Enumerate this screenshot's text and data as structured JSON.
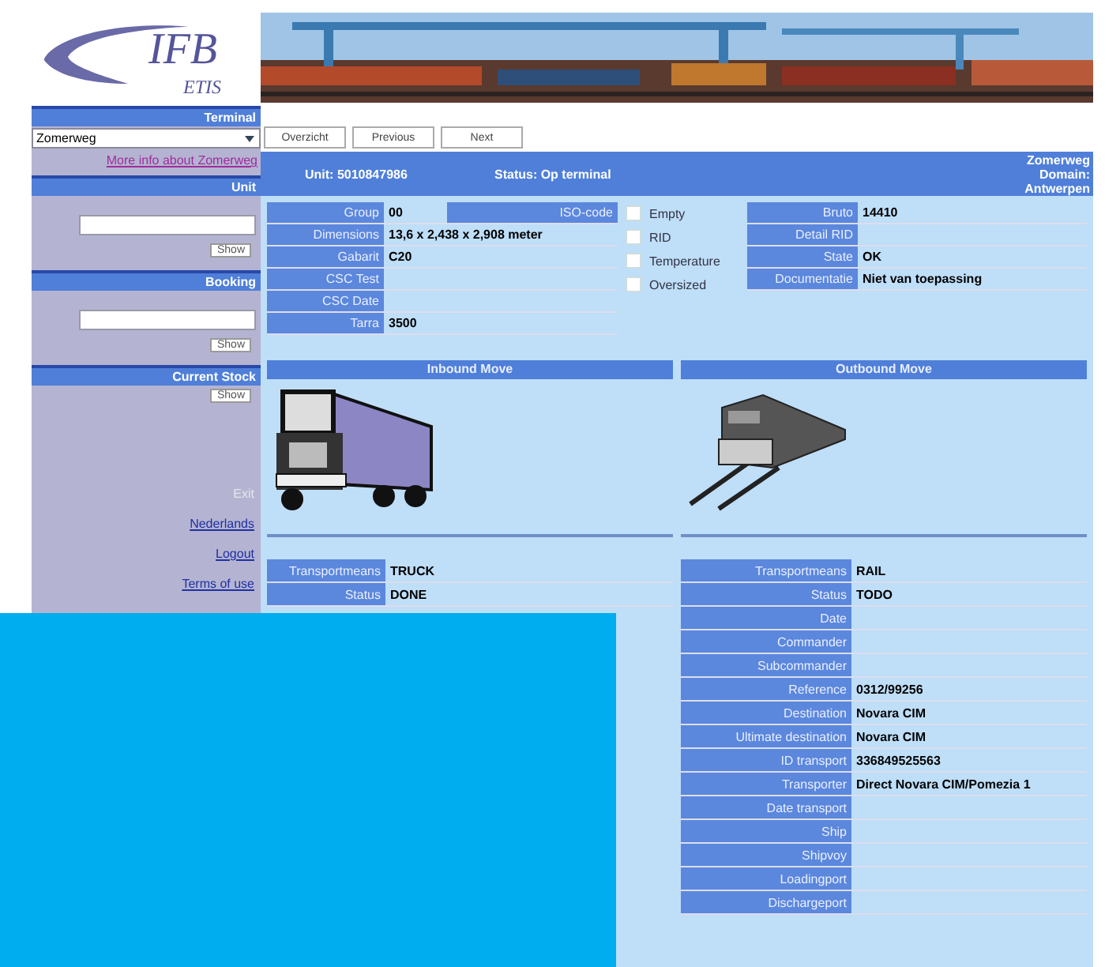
{
  "logo": {
    "title": "IFB",
    "subtitle": "ETIS"
  },
  "header_image": {
    "kind": "picture"
  },
  "sidebar": {
    "sections": [
      {
        "title": "Terminal",
        "kind": "select",
        "value": "Zomerweg",
        "link": "More info about Zomerweg"
      },
      {
        "title": "Unit",
        "kind": "search",
        "button": "Show"
      },
      {
        "title": "Booking",
        "kind": "search",
        "button": "Show"
      },
      {
        "title": "Current Stock",
        "kind": "button",
        "button": "Show"
      }
    ],
    "links": [
      {
        "label": "Exit",
        "kind": "text"
      },
      {
        "label": "Nederlands",
        "kind": "link"
      },
      {
        "label": "Logout",
        "kind": "link"
      },
      {
        "label": "Terms of use",
        "kind": "link"
      }
    ]
  },
  "nav_buttons": [
    "Overzicht",
    "Previous",
    "Next"
  ],
  "unit_bar": {
    "unit": "Unit: 5010847986",
    "status": "Status: Op terminal",
    "terminal": "Zomerweg",
    "domain": "Domain:",
    "location": "Antwerpen"
  },
  "details": {
    "iso_label": "ISO-code",
    "left": [
      {
        "label": "Group",
        "value": "00"
      },
      {
        "label": "Dimensions",
        "value": "13,6 x 2,438 x 2,908 meter"
      },
      {
        "label": "Gabarit",
        "value": "C20"
      },
      {
        "label": "CSC Test"
      },
      {
        "label": "CSC Date"
      },
      {
        "label": "Tarra",
        "value": "3500"
      }
    ],
    "checkboxes": [
      {
        "label": "Empty",
        "checked": false
      },
      {
        "label": "RID",
        "checked": false
      },
      {
        "label": "Temperature",
        "checked": false
      },
      {
        "label": "Oversized",
        "checked": false
      }
    ],
    "right": [
      {
        "label": "Bruto",
        "value": "14410"
      },
      {
        "label": "Detail RID"
      },
      {
        "label": "State",
        "value": "OK"
      },
      {
        "label": "Documentatie",
        "value": "Niet van toepassing"
      }
    ]
  },
  "moves": [
    {
      "title": "Inbound Move",
      "kind": "truck",
      "rows": [
        {
          "label": "Transportmeans",
          "value": "TRUCK"
        },
        {
          "label": "Status",
          "value": "DONE"
        }
      ]
    },
    {
      "title": "Outbound Move",
      "kind": "train",
      "rows": [
        {
          "label": "Transportmeans",
          "value": "RAIL"
        },
        {
          "label": "Status",
          "value": "TODO"
        },
        {
          "label": "Date"
        },
        {
          "label": "Commander"
        },
        {
          "label": "Subcommander"
        },
        {
          "label": "Reference",
          "value": "0312/99256"
        },
        {
          "label": "Destination",
          "value": "Novara CIM"
        },
        {
          "label": "Ultimate destination",
          "value": "Novara CIM"
        },
        {
          "label": "ID transport",
          "value": "336849525563"
        },
        {
          "label": "Transporter",
          "value": "Direct Novara CIM/Pomezia 1"
        },
        {
          "label": "Date transport"
        },
        {
          "label": "Ship"
        },
        {
          "label": "Shipvoy"
        },
        {
          "label": "Loadingport"
        },
        {
          "label": "Dischargeport"
        }
      ]
    }
  ]
}
